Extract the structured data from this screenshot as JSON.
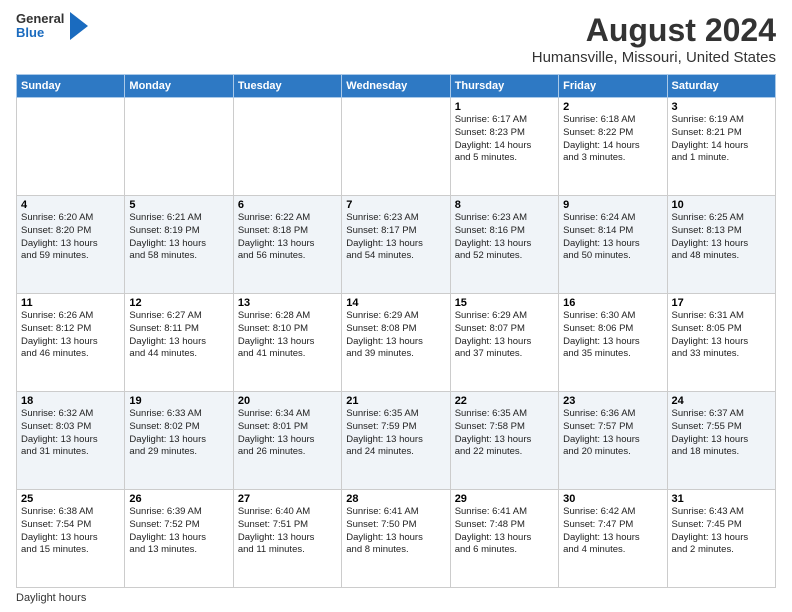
{
  "header": {
    "logo": {
      "general": "General",
      "blue": "Blue"
    },
    "title": "August 2024",
    "subtitle": "Humansville, Missouri, United States"
  },
  "calendar": {
    "days_of_week": [
      "Sunday",
      "Monday",
      "Tuesday",
      "Wednesday",
      "Thursday",
      "Friday",
      "Saturday"
    ],
    "weeks": [
      [
        {
          "day": "",
          "info": ""
        },
        {
          "day": "",
          "info": ""
        },
        {
          "day": "",
          "info": ""
        },
        {
          "day": "",
          "info": ""
        },
        {
          "day": "1",
          "info": "Sunrise: 6:17 AM\nSunset: 8:23 PM\nDaylight: 14 hours\nand 5 minutes."
        },
        {
          "day": "2",
          "info": "Sunrise: 6:18 AM\nSunset: 8:22 PM\nDaylight: 14 hours\nand 3 minutes."
        },
        {
          "day": "3",
          "info": "Sunrise: 6:19 AM\nSunset: 8:21 PM\nDaylight: 14 hours\nand 1 minute."
        }
      ],
      [
        {
          "day": "4",
          "info": "Sunrise: 6:20 AM\nSunset: 8:20 PM\nDaylight: 13 hours\nand 59 minutes."
        },
        {
          "day": "5",
          "info": "Sunrise: 6:21 AM\nSunset: 8:19 PM\nDaylight: 13 hours\nand 58 minutes."
        },
        {
          "day": "6",
          "info": "Sunrise: 6:22 AM\nSunset: 8:18 PM\nDaylight: 13 hours\nand 56 minutes."
        },
        {
          "day": "7",
          "info": "Sunrise: 6:23 AM\nSunset: 8:17 PM\nDaylight: 13 hours\nand 54 minutes."
        },
        {
          "day": "8",
          "info": "Sunrise: 6:23 AM\nSunset: 8:16 PM\nDaylight: 13 hours\nand 52 minutes."
        },
        {
          "day": "9",
          "info": "Sunrise: 6:24 AM\nSunset: 8:14 PM\nDaylight: 13 hours\nand 50 minutes."
        },
        {
          "day": "10",
          "info": "Sunrise: 6:25 AM\nSunset: 8:13 PM\nDaylight: 13 hours\nand 48 minutes."
        }
      ],
      [
        {
          "day": "11",
          "info": "Sunrise: 6:26 AM\nSunset: 8:12 PM\nDaylight: 13 hours\nand 46 minutes."
        },
        {
          "day": "12",
          "info": "Sunrise: 6:27 AM\nSunset: 8:11 PM\nDaylight: 13 hours\nand 44 minutes."
        },
        {
          "day": "13",
          "info": "Sunrise: 6:28 AM\nSunset: 8:10 PM\nDaylight: 13 hours\nand 41 minutes."
        },
        {
          "day": "14",
          "info": "Sunrise: 6:29 AM\nSunset: 8:08 PM\nDaylight: 13 hours\nand 39 minutes."
        },
        {
          "day": "15",
          "info": "Sunrise: 6:29 AM\nSunset: 8:07 PM\nDaylight: 13 hours\nand 37 minutes."
        },
        {
          "day": "16",
          "info": "Sunrise: 6:30 AM\nSunset: 8:06 PM\nDaylight: 13 hours\nand 35 minutes."
        },
        {
          "day": "17",
          "info": "Sunrise: 6:31 AM\nSunset: 8:05 PM\nDaylight: 13 hours\nand 33 minutes."
        }
      ],
      [
        {
          "day": "18",
          "info": "Sunrise: 6:32 AM\nSunset: 8:03 PM\nDaylight: 13 hours\nand 31 minutes."
        },
        {
          "day": "19",
          "info": "Sunrise: 6:33 AM\nSunset: 8:02 PM\nDaylight: 13 hours\nand 29 minutes."
        },
        {
          "day": "20",
          "info": "Sunrise: 6:34 AM\nSunset: 8:01 PM\nDaylight: 13 hours\nand 26 minutes."
        },
        {
          "day": "21",
          "info": "Sunrise: 6:35 AM\nSunset: 7:59 PM\nDaylight: 13 hours\nand 24 minutes."
        },
        {
          "day": "22",
          "info": "Sunrise: 6:35 AM\nSunset: 7:58 PM\nDaylight: 13 hours\nand 22 minutes."
        },
        {
          "day": "23",
          "info": "Sunrise: 6:36 AM\nSunset: 7:57 PM\nDaylight: 13 hours\nand 20 minutes."
        },
        {
          "day": "24",
          "info": "Sunrise: 6:37 AM\nSunset: 7:55 PM\nDaylight: 13 hours\nand 18 minutes."
        }
      ],
      [
        {
          "day": "25",
          "info": "Sunrise: 6:38 AM\nSunset: 7:54 PM\nDaylight: 13 hours\nand 15 minutes."
        },
        {
          "day": "26",
          "info": "Sunrise: 6:39 AM\nSunset: 7:52 PM\nDaylight: 13 hours\nand 13 minutes."
        },
        {
          "day": "27",
          "info": "Sunrise: 6:40 AM\nSunset: 7:51 PM\nDaylight: 13 hours\nand 11 minutes."
        },
        {
          "day": "28",
          "info": "Sunrise: 6:41 AM\nSunset: 7:50 PM\nDaylight: 13 hours\nand 8 minutes."
        },
        {
          "day": "29",
          "info": "Sunrise: 6:41 AM\nSunset: 7:48 PM\nDaylight: 13 hours\nand 6 minutes."
        },
        {
          "day": "30",
          "info": "Sunrise: 6:42 AM\nSunset: 7:47 PM\nDaylight: 13 hours\nand 4 minutes."
        },
        {
          "day": "31",
          "info": "Sunrise: 6:43 AM\nSunset: 7:45 PM\nDaylight: 13 hours\nand 2 minutes."
        }
      ]
    ]
  },
  "footer": {
    "daylight_hours": "Daylight hours"
  }
}
